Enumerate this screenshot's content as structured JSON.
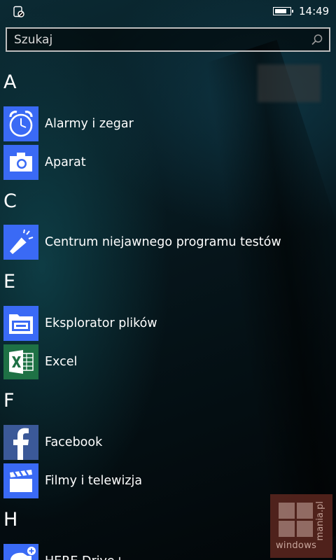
{
  "status_bar": {
    "time": "14:49",
    "battery_level": 0.85,
    "left_icon": "do-not-disturb-icon"
  },
  "search": {
    "placeholder": "Szukaj",
    "icon": "search-icon"
  },
  "groups": [
    {
      "letter": "A"
    },
    {
      "letter": "C"
    },
    {
      "letter": "E"
    },
    {
      "letter": "F"
    },
    {
      "letter": "H"
    }
  ],
  "apps": {
    "alarms": {
      "label": "Alarmy i zegar",
      "icon": "alarm-clock-icon",
      "tile_color": "#3a6af5"
    },
    "camera": {
      "label": "Aparat",
      "icon": "camera-icon",
      "tile_color": "#3a6af5"
    },
    "insider": {
      "label": "Centrum niejawnego programu testów",
      "icon": "megaphone-icon",
      "tile_color": "#3a6af5"
    },
    "explorer": {
      "label": "Eksplorator plików",
      "icon": "folder-icon",
      "tile_color": "#3a6af5"
    },
    "excel": {
      "label": "Excel",
      "icon": "excel-icon",
      "tile_color": "#1e7145"
    },
    "facebook": {
      "label": "Facebook",
      "icon": "facebook-icon",
      "tile_color": "#3b5998"
    },
    "films": {
      "label": "Filmy i telewizja",
      "icon": "clapperboard-icon",
      "tile_color": "#3a6af5"
    },
    "here": {
      "label": "HERE Drive+",
      "icon": "car-icon",
      "tile_color": "#3a6af5"
    }
  },
  "watermark": {
    "text_bottom": "windows",
    "text_vertical": "mania.pl"
  }
}
